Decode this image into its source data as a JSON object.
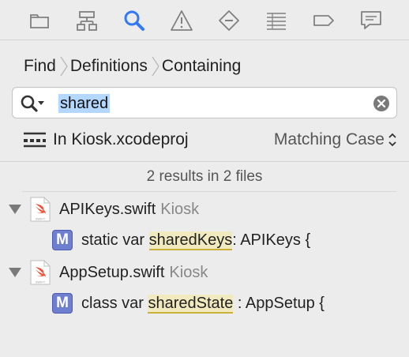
{
  "navigator": {
    "tabs": [
      {
        "name": "project-navigator",
        "icon": "folder-icon"
      },
      {
        "name": "symbol-navigator",
        "icon": "hierarchy-icon"
      },
      {
        "name": "find-navigator",
        "icon": "search-icon",
        "active": true
      },
      {
        "name": "issue-navigator",
        "icon": "warning-icon"
      },
      {
        "name": "test-navigator",
        "icon": "diamond-minus-icon"
      },
      {
        "name": "debug-navigator",
        "icon": "list-icon"
      },
      {
        "name": "breakpoint-navigator",
        "icon": "tag-icon"
      },
      {
        "name": "report-navigator",
        "icon": "speech-bubble-icon"
      }
    ],
    "active_color": "#3478f6",
    "icon_color": "#808080"
  },
  "breadcrumb": {
    "mode": "Find",
    "kind": "Definitions",
    "match": "Containing"
  },
  "search": {
    "value": "shared"
  },
  "scope": {
    "label": "In Kiosk.xcodeproj",
    "matching": "Matching Case"
  },
  "results": {
    "summary": "2 results in 2 files",
    "files": [
      {
        "name": "APIKeys.swift",
        "group": "Kiosk",
        "match": {
          "prefix": "static var ",
          "highlight": "sharedKeys",
          "suffix": ": APIKeys {",
          "badge": "M"
        }
      },
      {
        "name": "AppSetup.swift",
        "group": "Kiosk",
        "match": {
          "prefix": "class var ",
          "highlight": "sharedState",
          "suffix": " : AppSetup {",
          "badge": "M"
        }
      }
    ]
  }
}
